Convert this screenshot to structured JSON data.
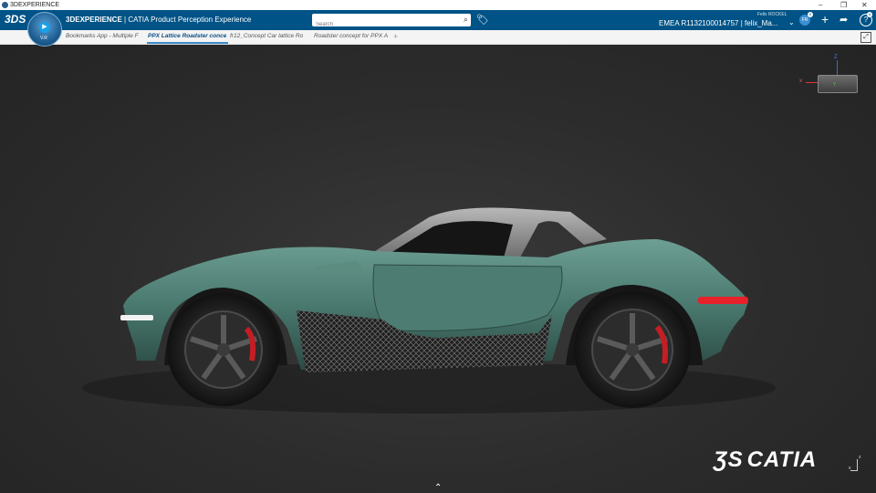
{
  "window": {
    "title": "3DEXPERIENCE",
    "controls": [
      "–",
      "❐",
      "✕"
    ]
  },
  "topbar": {
    "logo": "3DS",
    "brand_bold": "3DEXPERIENCE",
    "brand_rest": " | CATIA ",
    "brand_app": "Product Perception Experience",
    "search_placeholder": "Search",
    "user_name": "Felix ROCKEL",
    "tenant": "EMEA R1132100014757 | felix_Ma...",
    "avatar_initials": "FR",
    "avatar_badge": "5",
    "help_badge": "A"
  },
  "compass": {
    "label": "V.R"
  },
  "tabs": [
    {
      "label": "Bookmarks App - Multiple F",
      "active": false
    },
    {
      "label": "PPX Lattice Roadster conce",
      "active": true
    },
    {
      "label": "fr12_Concept Car lattice Ro",
      "active": false
    },
    {
      "label": "Roadster concept for PPX A",
      "active": false
    }
  ],
  "viewport": {
    "axes": {
      "x": "x",
      "y": "Y",
      "z": "Z"
    },
    "watermark_brand": "CATIA",
    "mini_axes": {
      "x": "x",
      "z": "z"
    }
  },
  "colors": {
    "topbar": "#005386",
    "car_body": "#3f6c62",
    "accent": "#3a89c9"
  }
}
